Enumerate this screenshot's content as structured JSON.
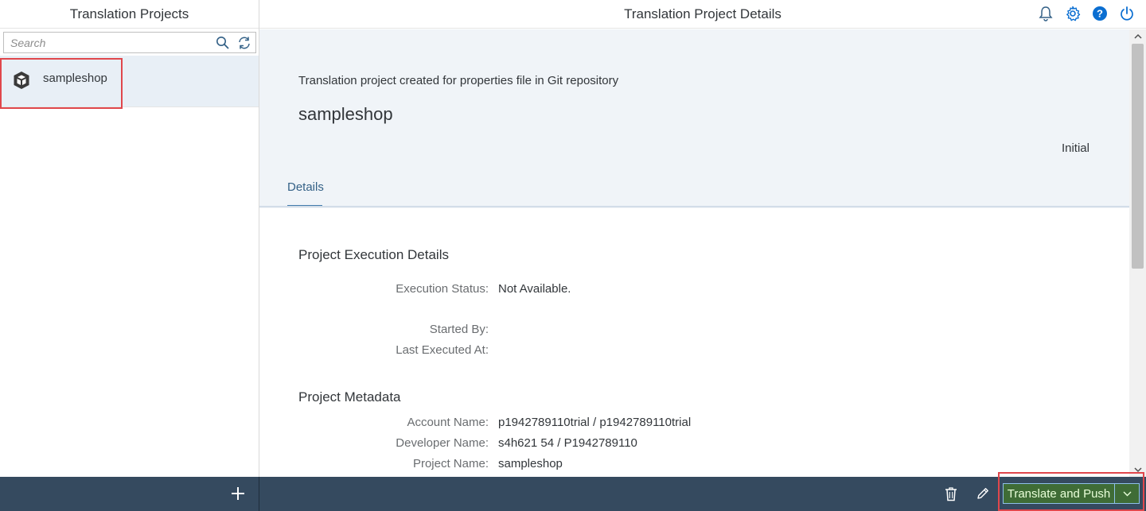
{
  "master": {
    "title": "Translation Projects",
    "search": {
      "placeholder": "Search"
    },
    "items": [
      {
        "title": "sampleshop",
        "icon": "product-cube-icon",
        "selected": true
      }
    ],
    "footer": {
      "add_icon": "plus-icon"
    }
  },
  "detail": {
    "title": "Translation Project Details",
    "header_icons": [
      "bell-icon",
      "gear-icon",
      "help-icon",
      "power-icon"
    ],
    "object": {
      "subtitle": "Translation project created for properties file in Git repository",
      "title": "sampleshop",
      "status": "Initial"
    },
    "tabs": [
      {
        "label": "Details",
        "selected": true
      }
    ],
    "sections": {
      "execution": {
        "title": "Project Execution Details",
        "fields": [
          {
            "label": "Execution Status:",
            "value": "Not Available."
          },
          {
            "label": "Started By:",
            "value": ""
          },
          {
            "label": "Last Executed At:",
            "value": ""
          }
        ]
      },
      "metadata": {
        "title": "Project Metadata",
        "fields": [
          {
            "label": "Account Name:",
            "value": "p1942789110trial / p1942789110trial"
          },
          {
            "label": "Developer Name:",
            "value": "s4h621 54 / P1942789110"
          },
          {
            "label": "Project Name:",
            "value": "sampleshop"
          }
        ]
      }
    },
    "footer": {
      "primary_action": "Translate and Push"
    }
  },
  "colors": {
    "accent": "#427cac",
    "footer_bg": "#354a5f",
    "highlight": "#e0474c",
    "selected_item_bg": "#e8eff6",
    "header_bg": "#f0f4f8",
    "primary_button_bg": "#3f6c36"
  }
}
